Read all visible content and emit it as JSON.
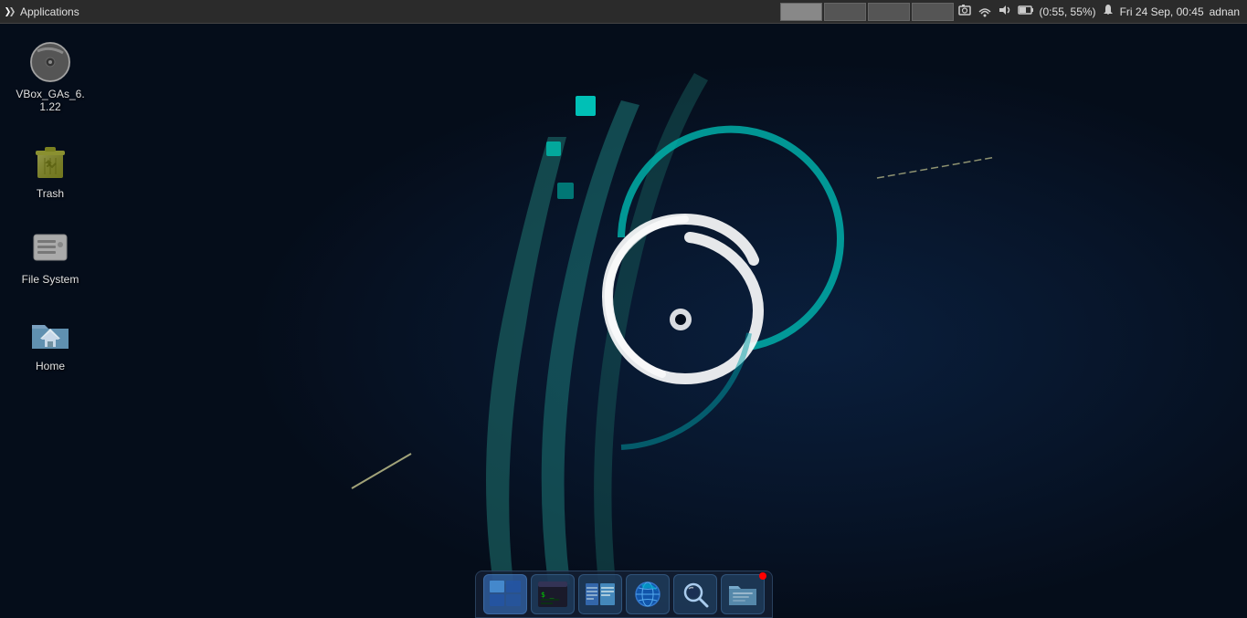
{
  "topbar": {
    "app_label": "Applications",
    "app_symbol": "✕",
    "workspaces": [
      "1",
      "2",
      "3",
      "4"
    ],
    "sys_icons": [
      "camera-icon",
      "network-icon",
      "volume-icon",
      "battery-icon",
      "bell-icon"
    ],
    "battery_status": "(0:55, 55%)",
    "datetime": "Fri 24 Sep, 00:45",
    "username": "adnan"
  },
  "desktop_icons": [
    {
      "id": "vbox",
      "label": "VBox_GAs_6.\n1.22",
      "label_line1": "VBox_GAs_6.",
      "label_line2": "1.22",
      "type": "disc"
    },
    {
      "id": "trash",
      "label": "Trash",
      "type": "trash"
    },
    {
      "id": "filesystem",
      "label": "File System",
      "type": "drive"
    },
    {
      "id": "home",
      "label": "Home",
      "type": "home-folder"
    }
  ],
  "taskbar": {
    "items": [
      {
        "id": "workspace-switcher",
        "type": "workspace"
      },
      {
        "id": "terminal",
        "type": "terminal"
      },
      {
        "id": "files",
        "type": "file-manager"
      },
      {
        "id": "browser",
        "type": "web-browser"
      },
      {
        "id": "search",
        "type": "search"
      },
      {
        "id": "fileman2",
        "type": "file-manager2"
      }
    ]
  }
}
